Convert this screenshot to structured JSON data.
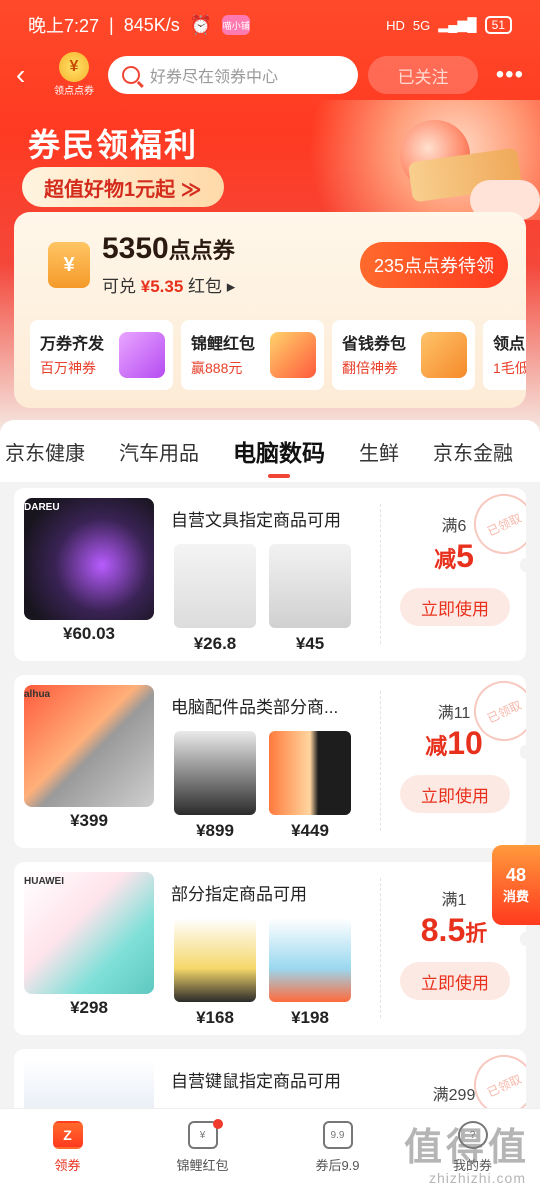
{
  "status_bar": {
    "time": "晚上7:27",
    "speed": "845K/s",
    "alarm_icon": "alarm-icon",
    "app_badge": "喵小铺",
    "network": "5G",
    "hd": "HD",
    "battery": "51"
  },
  "nav": {
    "logo_label": "领点点券",
    "search_placeholder": "好券尽在领券中心",
    "follow_label": "已关注",
    "more_label": "•••"
  },
  "banner": {
    "title": "券民领福利",
    "pill": "超值好物1元起 ≫"
  },
  "points": {
    "amount": "5350",
    "unit": "点点券",
    "sub_prefix": "可兑",
    "sub_value": "¥5.35",
    "sub_suffix": "红包 ▸",
    "pending_button": "235点点券待领",
    "features": [
      {
        "title": "万券齐发",
        "subtitle": "百万神券"
      },
      {
        "title": "锦鲤红包",
        "subtitle": "赢888元"
      },
      {
        "title": "省钱券包",
        "subtitle": "翻倍神券"
      },
      {
        "title": "领点",
        "subtitle": "1毛低"
      }
    ]
  },
  "tabs": [
    "京东健康",
    "汽车用品",
    "电脑数码",
    "生鲜",
    "京东金融"
  ],
  "coupons": [
    {
      "brand": "DAREU",
      "title": "自营文具指定商品可用",
      "hero_price": "¥60.03",
      "products": [
        "¥26.8",
        "¥45"
      ],
      "condition": "满6",
      "amount_prefix": "减",
      "amount_value": "5",
      "amount_suffix": "",
      "button": "立即使用",
      "stamp": "已领取"
    },
    {
      "brand": "alhua",
      "title": "电脑配件品类部分商...",
      "hero_price": "¥399",
      "products": [
        "¥899",
        "¥449"
      ],
      "condition": "满11",
      "amount_prefix": "减",
      "amount_value": "10",
      "amount_suffix": "",
      "button": "立即使用",
      "stamp": "已领取"
    },
    {
      "brand": "HUAWEI",
      "title": "部分指定商品可用",
      "hero_price": "¥298",
      "products": [
        "¥168",
        "¥198"
      ],
      "condition": "满1",
      "amount_prefix": "",
      "amount_value": "8.5",
      "amount_suffix": "折",
      "button": "立即使用",
      "stamp": ""
    },
    {
      "brand": "",
      "title": "自营键鼠指定商品可用",
      "hero_price": "",
      "products": [
        "",
        ""
      ],
      "condition": "满299",
      "amount_prefix": "",
      "amount_value": "",
      "amount_suffix": "",
      "button": "",
      "stamp": "已领取"
    }
  ],
  "float_badge": {
    "number": "48",
    "label": "消费"
  },
  "bottom_nav": [
    {
      "label": "领券",
      "icon": "coupon-icon"
    },
    {
      "label": "锦鲤红包",
      "icon": "red-packet-icon"
    },
    {
      "label": "券后9.9",
      "icon": "price-tag-icon",
      "glyph": "9.9"
    },
    {
      "label": "我的券",
      "icon": "my-coupons-icon"
    }
  ],
  "watermark": {
    "main": "值得值",
    "sub": "zhizhizhi.com"
  },
  "colors": {
    "brand_red": "#f04535",
    "accent_orange": "#ff6a2c"
  }
}
